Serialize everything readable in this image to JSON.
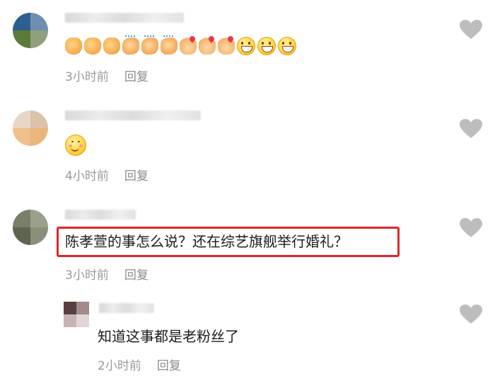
{
  "comments": [
    {
      "time": "3小时前",
      "reply": "回复",
      "emojis": [
        "thumbs-up",
        "thumbs-up",
        "thumbs-up",
        "clap",
        "clap",
        "clap",
        "finger-heart",
        "finger-heart",
        "finger-heart",
        "grin",
        "grin",
        "grin"
      ]
    },
    {
      "time": "4小时前",
      "reply": "回复",
      "emojis": [
        "blush-smile"
      ]
    },
    {
      "text": "陈孝萱的事怎么说？还在综艺旗舰举行婚礼？",
      "time": "3小时前",
      "reply": "回复"
    },
    {
      "text": "知道这事都是老粉丝了",
      "time": "2小时前",
      "reply": "回复"
    }
  ],
  "colors": {
    "highlight": "#e0262b",
    "like_icon": "#bdbdbd",
    "meta_text": "#9a9a9a"
  }
}
